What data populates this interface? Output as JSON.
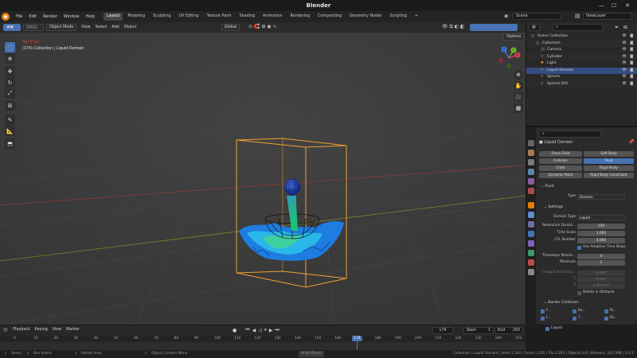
{
  "window": {
    "title": "Blender"
  },
  "menu": [
    "File",
    "Edit",
    "Render",
    "Window",
    "Help"
  ],
  "workspaces": [
    {
      "label": "Layout",
      "active": true
    },
    {
      "label": "Modeling"
    },
    {
      "label": "Sculpting"
    },
    {
      "label": "UV Editing"
    },
    {
      "label": "Texture Paint"
    },
    {
      "label": "Shading"
    },
    {
      "label": "Animation"
    },
    {
      "label": "Rendering"
    },
    {
      "label": "Compositing"
    },
    {
      "label": "Geometry Nodes"
    },
    {
      "label": "Scripting"
    }
  ],
  "scene": {
    "label": "Scene",
    "view_layer": "ViewLayer"
  },
  "viewport": {
    "mode": "Object Mode",
    "menus": [
      "View",
      "Select",
      "Add",
      "Object"
    ],
    "orientation": "Global",
    "options": "Options",
    "overlay_line1": "Top Z-Up",
    "overlay_line2": "(174) Collection | Liquid Domain",
    "gizmo_axes": [
      "X",
      "Y",
      "Z"
    ]
  },
  "outliner": {
    "search_placeholder": "",
    "rows": [
      {
        "label": "Scene Collection",
        "indent": 0,
        "icon": "collection"
      },
      {
        "label": "Collection",
        "indent": 1,
        "icon": "collection"
      },
      {
        "label": "Camera",
        "indent": 2,
        "icon": "camera"
      },
      {
        "label": "Cylinder",
        "indent": 2,
        "icon": "mesh"
      },
      {
        "label": "Light",
        "indent": 2,
        "icon": "light"
      },
      {
        "label": "Liquid Domain",
        "indent": 2,
        "icon": "mesh",
        "selected": true
      },
      {
        "label": "Sphere",
        "indent": 2,
        "icon": "mesh"
      },
      {
        "label": "Sphere.001",
        "indent": 2,
        "icon": "mesh"
      }
    ]
  },
  "properties": {
    "object_name": "Liquid Domain",
    "physics_buttons": [
      [
        "Force Field",
        "Soft Body"
      ],
      [
        "Collision",
        "Fluid"
      ],
      [
        "Cloth",
        "Rigid Body"
      ],
      [
        "Dynamic Paint",
        "Rigid Body Constraint"
      ]
    ],
    "fluid_section": "Fluid",
    "type_label": "Type",
    "type_value": "Domain",
    "settings_section": "Settings",
    "domain_type_label": "Domain Type",
    "domain_type_value": "Liquid",
    "resolution_label": "Resolution Divisio...",
    "resolution_value": "120",
    "time_scale_label": "Time Scale",
    "time_scale_value": "1.000",
    "cfl_label": "CFL Number",
    "cfl_value": "4.000",
    "adaptive_label": "Use Adaptive Time Steps",
    "timesteps_max_label": "Timesteps Maxim...",
    "timesteps_max_value": "4",
    "minimum_label": "Minimum",
    "minimum_value": "1",
    "gravity_label": "Using Scene Grav...",
    "gravity_x": "0 m/s²",
    "gravity_y": "0 m/s²",
    "gravity_z": "-9.81 m/s²",
    "axis_y": "Y",
    "axis_z": "Z",
    "delete_obstacle_label": "Delete in Obstacle",
    "border_section": "Border Collisions",
    "border_items": [
      "F...",
      "Ba...",
      "Ri...",
      "L...",
      "T...",
      "Bo..."
    ],
    "liquid_section": "Liquid",
    "sim_method_label": "Simulation Method",
    "sim_method_value": "FLIP",
    "flip_ratio_label": "FLIP Ratio",
    "flip_ratio_value": "0.970"
  },
  "timeline": {
    "menus": [
      "Playback",
      "Keying",
      "View",
      "Marker"
    ],
    "current_frame": "174",
    "start_label": "Start",
    "start_value": "1",
    "end_label": "End",
    "end_value": "250",
    "ticks": [
      "0",
      "10",
      "20",
      "30",
      "40",
      "50",
      "60",
      "70",
      "80",
      "90",
      "100",
      "110",
      "120",
      "130",
      "140",
      "150",
      "160",
      "170",
      "180",
      "190",
      "200",
      "210",
      "220",
      "230",
      "240",
      "250"
    ]
  },
  "statusbar": {
    "items": [
      "Select",
      "Box Select",
      "Rotate View",
      "Object Context Menu"
    ],
    "center": "Anim Player",
    "stats": "Collection | Liquid Domain | Verts:1,164 | Faces:1,156 | Tris:2,262 | Objects:1/6 | Memory: 30.2 MiB | 3.0.1"
  },
  "colors": {
    "accent": "#4772b3",
    "selection": "#e87d0d",
    "liquid": "#1e90ff",
    "domain_box": "#f0a030"
  }
}
